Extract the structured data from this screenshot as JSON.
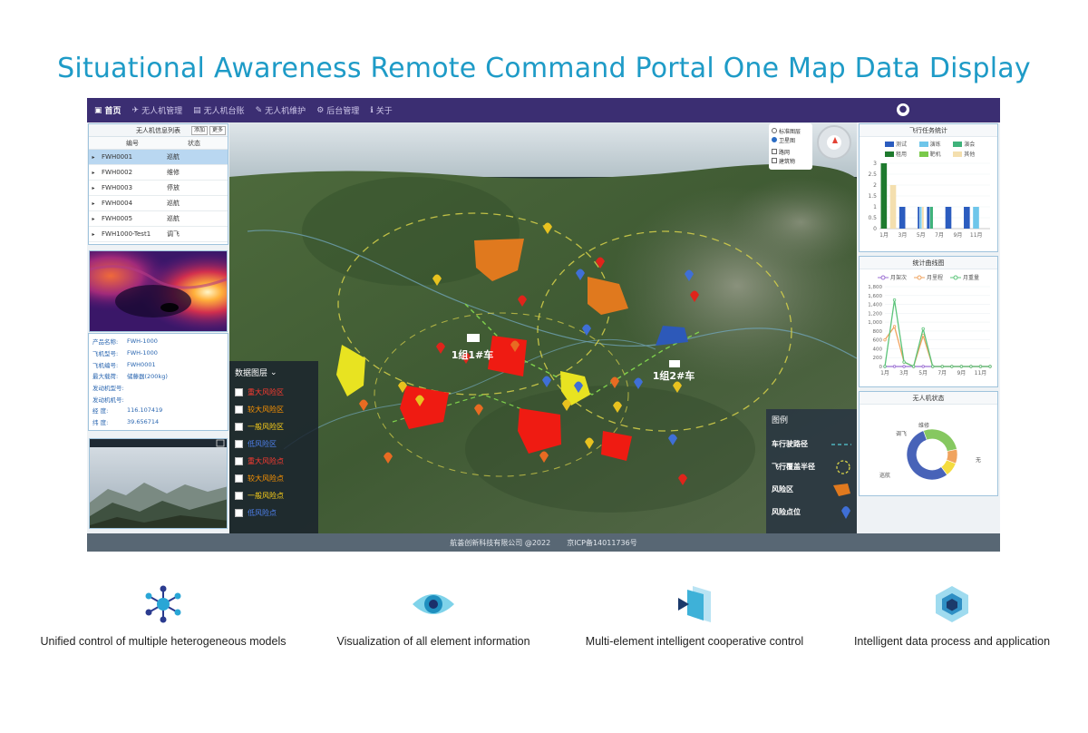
{
  "headline": "Situational Awareness Remote Command Portal One Map Data Display",
  "nav": {
    "items": [
      {
        "icon": "map-icon",
        "label": "首页"
      },
      {
        "icon": "drone-icon",
        "label": "无人机管理"
      },
      {
        "icon": "ledger-icon",
        "label": "无人机台账"
      },
      {
        "icon": "wrench-icon",
        "label": "无人机维护"
      },
      {
        "icon": "gears-icon",
        "label": "后台管理"
      },
      {
        "icon": "info-icon",
        "label": "关于"
      }
    ],
    "user_icon": "user-icon"
  },
  "device_list": {
    "title": "无人机信息列表",
    "btn_add": "添加",
    "btn_more": "更多",
    "headers": [
      "编号",
      "状态"
    ],
    "rows": [
      {
        "id": "FWH0001",
        "status": "巡航"
      },
      {
        "id": "FWH0002",
        "status": "维修"
      },
      {
        "id": "FWH0003",
        "status": "停放"
      },
      {
        "id": "FWH0004",
        "status": "巡航"
      },
      {
        "id": "FWH0005",
        "status": "巡航"
      },
      {
        "id": "FWH1000-Test1",
        "status": "调飞"
      }
    ]
  },
  "drone_info": [
    {
      "k": "产品名称:",
      "v": "FWH-1000"
    },
    {
      "k": "飞机型号:",
      "v": "FWH-1000"
    },
    {
      "k": "飞机编号:",
      "v": "FWH0001"
    },
    {
      "k": "最大载荷:",
      "v": "储藤器(200kg)"
    },
    {
      "k": "发动机型号:",
      "v": ""
    },
    {
      "k": "发动机机号:",
      "v": ""
    },
    {
      "k": "经 度:",
      "v": "116.107419"
    },
    {
      "k": "纬 度:",
      "v": "39.656714"
    }
  ],
  "map": {
    "controls": {
      "opt1": "标准图层",
      "opt2": "卫星图",
      "chk1": "路网",
      "chk2": "建筑物"
    },
    "vehicle1": "1组1#车",
    "vehicle2": "1组2#车",
    "layers_title": "数据图层",
    "layers": [
      {
        "label": "重大风险区",
        "color": "#ff3b30"
      },
      {
        "label": "较大风险区",
        "color": "#ff9500"
      },
      {
        "label": "一般风险区",
        "color": "#ffd21a"
      },
      {
        "label": "低风险区",
        "color": "#3d6fe0"
      },
      {
        "label": "重大风险点",
        "color": "#ff3b30"
      },
      {
        "label": "较大风险点",
        "color": "#ff9500"
      },
      {
        "label": "一般风险点",
        "color": "#ffd21a"
      },
      {
        "label": "低风险点",
        "color": "#3d6fe0"
      }
    ],
    "legend_title": "图例",
    "legend": [
      "车行驶路径",
      "飞行覆盖半径",
      "风险区",
      "风险点位"
    ]
  },
  "footer": {
    "company": "航荟创新科技有限公司 @2022",
    "icp": "京ICP备14011736号"
  },
  "charts": {
    "bar_title": "飞行任务统计",
    "bar_legend": [
      {
        "label": "测试",
        "color": "#2b5cbf"
      },
      {
        "label": "演练",
        "color": "#6ec6ea"
      },
      {
        "label": "演会",
        "color": "#3fb27a"
      },
      {
        "label": "租用",
        "color": "#1e7a2e"
      },
      {
        "label": "靶机",
        "color": "#79c94a"
      },
      {
        "label": "其他",
        "color": "#f4dfae"
      }
    ],
    "line_title": "统计曲线图",
    "line_legend": [
      {
        "label": "月架次",
        "color": "#9b6fd3"
      },
      {
        "label": "月里程",
        "color": "#f0a35e"
      },
      {
        "label": "月重量",
        "color": "#5cc47a"
      }
    ],
    "donut_title": "无人机状态",
    "donut_labels": {
      "a": "维修",
      "b": "调飞",
      "c": "巡航",
      "d": "无"
    }
  },
  "chart_data": [
    {
      "type": "bar",
      "title": "飞行任务统计",
      "categories": [
        "1月",
        "2月",
        "3月",
        "4月",
        "5月",
        "6月",
        "7月",
        "8月",
        "9月",
        "10月",
        "11月",
        "12月"
      ],
      "x_tick_labels": [
        "1月",
        "3月",
        "5月",
        "7月",
        "9月",
        "11月"
      ],
      "ylim": [
        0,
        3
      ],
      "y_ticks": [
        "0",
        "0.5",
        "1",
        "1.5",
        "2",
        "2.5",
        "3"
      ],
      "series": [
        {
          "name": "测试",
          "values": [
            0,
            0,
            1,
            0,
            1,
            1,
            0,
            1,
            0,
            1,
            0,
            0
          ]
        },
        {
          "name": "演练",
          "values": [
            0,
            0,
            0,
            0,
            1,
            0,
            0,
            0,
            0,
            0,
            1,
            0
          ]
        },
        {
          "name": "演会",
          "values": [
            0,
            0,
            0,
            0,
            0,
            1,
            0,
            0,
            0,
            0,
            0,
            0
          ]
        },
        {
          "name": "租用",
          "values": [
            3,
            0,
            0,
            0,
            0,
            0,
            0,
            0,
            0,
            0,
            0,
            0
          ]
        },
        {
          "name": "靶机",
          "values": [
            0,
            0,
            0,
            0,
            0,
            0,
            0,
            0,
            0,
            0,
            0,
            0
          ]
        },
        {
          "name": "其他",
          "values": [
            0,
            2,
            0,
            0,
            1,
            0,
            0,
            0,
            0,
            0,
            0,
            0
          ]
        }
      ]
    },
    {
      "type": "line",
      "title": "统计曲线图",
      "categories": [
        "1月",
        "2月",
        "3月",
        "4月",
        "5月",
        "6月",
        "7月",
        "8月",
        "9月",
        "10月",
        "11月",
        "12月"
      ],
      "x_tick_labels": [
        "1月",
        "3月",
        "5月",
        "7月",
        "9月",
        "11月"
      ],
      "ylim": [
        0,
        1800
      ],
      "y_ticks": [
        "0",
        "200",
        "400",
        "600",
        "800",
        "1,000",
        "1,200",
        "1,400",
        "1,600",
        "1,800"
      ],
      "series": [
        {
          "name": "月架次",
          "values": [
            0,
            0,
            0,
            0,
            0,
            0,
            0,
            0,
            0,
            0,
            0,
            0
          ]
        },
        {
          "name": "月里程",
          "values": [
            600,
            900,
            100,
            0,
            700,
            0,
            0,
            0,
            0,
            0,
            0,
            0
          ]
        },
        {
          "name": "月重量",
          "values": [
            0,
            1500,
            100,
            0,
            850,
            0,
            0,
            0,
            0,
            0,
            0,
            0
          ]
        }
      ]
    },
    {
      "type": "pie",
      "title": "无人机状态",
      "categories": [
        "巡航",
        "维修",
        "调飞",
        "无"
      ],
      "values": [
        3,
        1,
        1,
        6
      ]
    }
  ],
  "features": [
    {
      "label": "Unified control of multiple heterogeneous models",
      "icon": "network-hub-icon"
    },
    {
      "label": "Visualization of all element information",
      "icon": "eye-icon"
    },
    {
      "label": "Multi-element intelligent cooperative control",
      "icon": "layered-arrow-icon"
    },
    {
      "label": "Intelligent data process and application",
      "icon": "hexagon-cube-icon"
    }
  ]
}
